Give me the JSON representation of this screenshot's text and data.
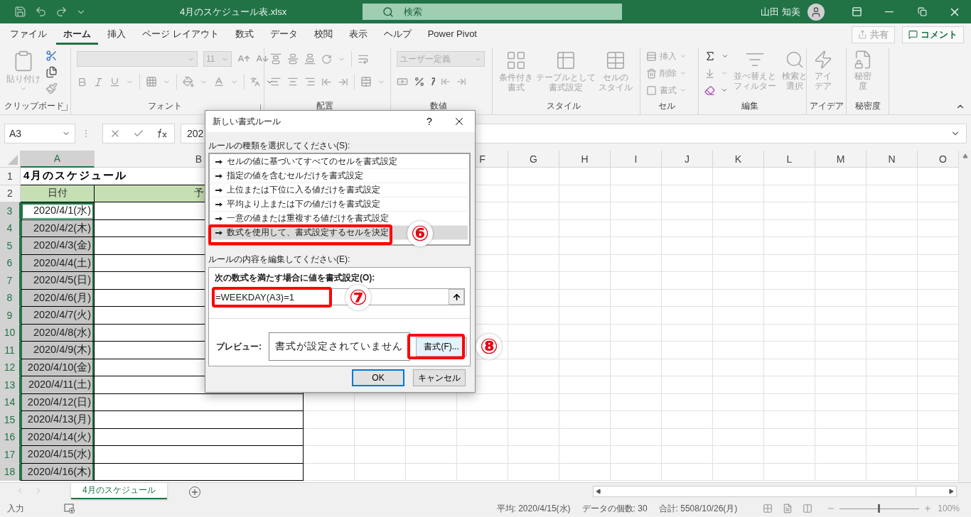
{
  "title_bar": {
    "file_name": "4月のスケジュール表.xlsx",
    "search_placeholder": "検索",
    "user": "山田 知美"
  },
  "menu_tabs": [
    {
      "label": "ファイル",
      "selected": false
    },
    {
      "label": "ホーム",
      "selected": true
    },
    {
      "label": "挿入",
      "selected": false
    },
    {
      "label": "ページ レイアウト",
      "selected": false
    },
    {
      "label": "数式",
      "selected": false
    },
    {
      "label": "データ",
      "selected": false
    },
    {
      "label": "校閲",
      "selected": false
    },
    {
      "label": "表示",
      "selected": false
    },
    {
      "label": "ヘルプ",
      "selected": false
    },
    {
      "label": "Power Pivot",
      "selected": false
    }
  ],
  "share_button": {
    "label": "共有",
    "disabled": true
  },
  "comment_button": {
    "label": "コメント",
    "disabled": false
  },
  "ribbon": {
    "clipboard": {
      "label": "クリップボード",
      "paste": {
        "label": "貼り付け",
        "disabled": true
      }
    },
    "font": {
      "label": "フォント",
      "size": "11"
    },
    "alignment": {
      "label": "配置"
    },
    "number": {
      "label": "数値",
      "format": "ユーザー定義"
    },
    "styles": {
      "label": "スタイル",
      "buttons": [
        {
          "label": "条件付き書式",
          "disabled": true
        },
        {
          "label": "テーブルとして書式設定",
          "disabled": true
        },
        {
          "label": "セルのスタイル",
          "disabled": true
        }
      ]
    },
    "cells": {
      "label": "セル",
      "buttons": [
        {
          "label": "挿入",
          "disabled": true
        },
        {
          "label": "削除",
          "disabled": true
        },
        {
          "label": "書式",
          "disabled": true
        }
      ]
    },
    "editing": {
      "label": "編集",
      "buttons": [
        {
          "label": "並べ替えとフィルター",
          "disabled": true
        },
        {
          "label": "検索と選択",
          "disabled": true
        }
      ]
    },
    "ideas": {
      "label": "アイデア",
      "button": {
        "label": "アイデア",
        "disabled": true
      }
    },
    "sensitivity": {
      "label": "秘密度",
      "button": {
        "label": "秘密度",
        "disabled": true
      }
    }
  },
  "formula_bar": {
    "name_box": "A3",
    "formula": "202"
  },
  "sheet": {
    "column_headers": [
      "A",
      "B",
      "F",
      "G",
      "H",
      "I",
      "J",
      "K",
      "L",
      "M",
      "N",
      "O"
    ],
    "rows": [
      {
        "row": "1",
        "kind": "title",
        "text": "4月のスケジュール",
        "selected": false
      },
      {
        "row": "2",
        "kind": "header",
        "a": "日付",
        "b": "予",
        "selected": false
      },
      {
        "row": "3",
        "kind": "date",
        "text": "2020/4/1(水)",
        "selected": true,
        "active": true
      },
      {
        "row": "4",
        "kind": "date",
        "text": "2020/4/2(木)",
        "selected": true,
        "active": false
      },
      {
        "row": "5",
        "kind": "date",
        "text": "2020/4/3(金)",
        "selected": true,
        "active": false
      },
      {
        "row": "6",
        "kind": "date",
        "text": "2020/4/4(土)",
        "selected": true,
        "active": false
      },
      {
        "row": "7",
        "kind": "date",
        "text": "2020/4/5(日)",
        "selected": true,
        "active": false
      },
      {
        "row": "8",
        "kind": "date",
        "text": "2020/4/6(月)",
        "selected": true,
        "active": false
      },
      {
        "row": "9",
        "kind": "date",
        "text": "2020/4/7(火)",
        "selected": true,
        "active": false
      },
      {
        "row": "10",
        "kind": "date",
        "text": "2020/4/8(水)",
        "selected": true,
        "active": false
      },
      {
        "row": "11",
        "kind": "date",
        "text": "2020/4/9(木)",
        "selected": true,
        "active": false
      },
      {
        "row": "12",
        "kind": "date",
        "text": "2020/4/10(金)",
        "selected": true,
        "active": false
      },
      {
        "row": "13",
        "kind": "date",
        "text": "2020/4/11(土)",
        "selected": true,
        "active": false
      },
      {
        "row": "14",
        "kind": "date",
        "text": "2020/4/12(日)",
        "selected": true,
        "active": false
      },
      {
        "row": "15",
        "kind": "date",
        "text": "2020/4/13(月)",
        "selected": true,
        "active": false
      },
      {
        "row": "16",
        "kind": "date",
        "text": "2020/4/14(火)",
        "selected": true,
        "active": false
      },
      {
        "row": "17",
        "kind": "date",
        "text": "2020/4/15(水)",
        "selected": true,
        "active": false
      },
      {
        "row": "18",
        "kind": "date",
        "text": "2020/4/16(木)",
        "selected": true,
        "active": false
      }
    ]
  },
  "dialog": {
    "title": "新しい書式ルール",
    "help": "?",
    "rule_type_label": "ルールの種類を選択してください(S):",
    "rule_types": [
      {
        "label": "セルの値に基づいてすべてのセルを書式設定",
        "selected": false
      },
      {
        "label": "指定の値を含むセルだけを書式設定",
        "selected": false
      },
      {
        "label": "上位または下位に入る値だけを書式設定",
        "selected": false
      },
      {
        "label": "平均より上または下の値だけを書式設定",
        "selected": false
      },
      {
        "label": "一意の値または重複する値だけを書式設定",
        "selected": false
      },
      {
        "label": "数式を使用して、書式設定するセルを決定",
        "selected": true
      }
    ],
    "edit_label": "ルールの内容を編集してください(E):",
    "condition_label": "次の数式を満たす場合に値を書式設定(O):",
    "formula_value": "=WEEKDAY(A3)=1",
    "preview_label": "プレビュー:",
    "preview_text": "書式が設定されていません",
    "format_button": "書式(F)...",
    "ok_button": "OK",
    "cancel_button": "キャンセル",
    "annotations": [
      "⑥",
      "⑦",
      "⑧"
    ]
  },
  "sheet_tabs": [
    {
      "label": "4月のスケジュール",
      "selected": true
    }
  ],
  "status_bar": {
    "mode": "入力",
    "average": "平均: 2020/4/15(水)",
    "count": "データの個数: 30",
    "sum": "合計: 5508/10/26(月)",
    "zoom": {
      "level": 0.5,
      "reading": "100%"
    }
  }
}
